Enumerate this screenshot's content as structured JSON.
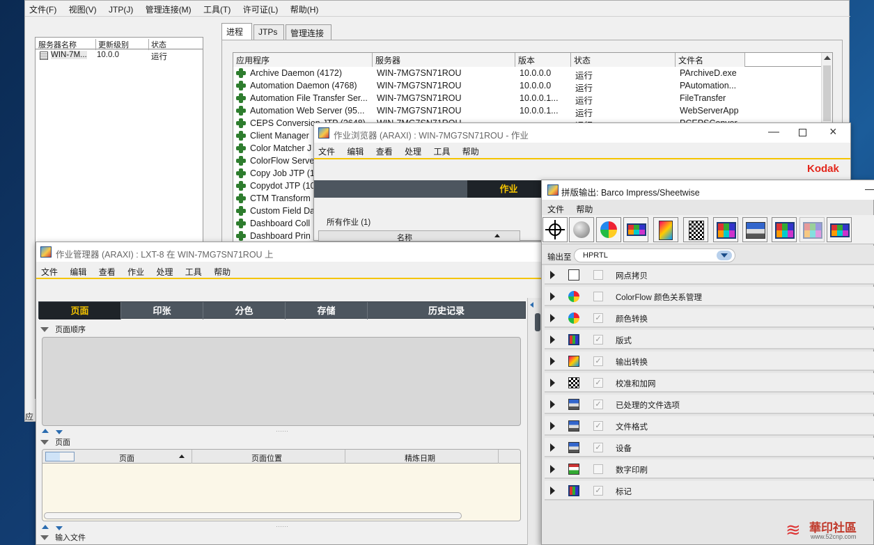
{
  "main_window": {
    "menu": [
      "文件(F)",
      "视图(V)",
      "JTP(J)",
      "管理连接(M)",
      "工具(T)",
      "许可证(L)",
      "帮助(H)"
    ],
    "server_table": {
      "headers": [
        "服务器名称",
        "更新级别",
        "状态"
      ],
      "rows": [
        {
          "name": "WIN-7M...",
          "version": "10.0.0",
          "status": "运行"
        }
      ]
    },
    "tabs": [
      "进程",
      "JTPs",
      "管理连接"
    ],
    "process_table": {
      "headers": [
        "应用程序",
        "服务器",
        "版本",
        "状态",
        "文件名"
      ],
      "rows": [
        [
          "Archive Daemon (4172)",
          "WIN-7MG7SN71ROU",
          "10.0.0.0",
          "运行",
          "PArchiveD.exe"
        ],
        [
          "Automation Daemon (4768)",
          "WIN-7MG7SN71ROU",
          "10.0.0.0",
          "运行",
          "PAutomation..."
        ],
        [
          "Automation File Transfer Ser...",
          "WIN-7MG7SN71ROU",
          "10.0.0.1...",
          "运行",
          "FileTransfer"
        ],
        [
          "Automation Web Server (95...",
          "WIN-7MG7SN71ROU",
          "10.0.0.1...",
          "运行",
          "WebServerApp"
        ],
        [
          "CEPS Conversion JTP (2648)",
          "WIN-7MG7SN71ROU",
          "",
          "运行",
          "PCEPSConver..."
        ],
        [
          "Client Manager",
          "",
          "",
          "",
          ""
        ],
        [
          "Color Matcher J",
          "",
          "",
          "",
          ""
        ],
        [
          "ColorFlow Serve",
          "",
          "",
          "",
          ""
        ],
        [
          "Copy Job JTP (1",
          "",
          "",
          "",
          ""
        ],
        [
          "Copydot JTP (10",
          "",
          "",
          "",
          ""
        ],
        [
          "CTM Transform",
          "",
          "",
          "",
          ""
        ],
        [
          "Custom Field Da",
          "",
          "",
          "",
          ""
        ],
        [
          "Dashboard Coll",
          "",
          "",
          "",
          ""
        ],
        [
          "Dashboard Prin",
          "",
          "",
          "",
          ""
        ]
      ]
    },
    "left_edge_char": "应"
  },
  "job_browser": {
    "title": "作业浏览器 (ARAXI) : WIN-7MG7SN71ROU - 作业",
    "menu": [
      "文件",
      "编辑",
      "查看",
      "处理",
      "工具",
      "帮助"
    ],
    "brand": "Kodak",
    "dark_tab": "作业",
    "all_jobs": "所有作业 (1)",
    "name_col": "名称"
  },
  "job_manager": {
    "title": "作业管理器 (ARAXI) : LXT-8 在 WIN-7MG7SN71ROU 上",
    "menu": [
      "文件",
      "编辑",
      "查看",
      "作业",
      "处理",
      "工具",
      "帮助"
    ],
    "tabs": [
      "页面",
      "印张",
      "分色",
      "存储",
      "历史记录"
    ],
    "page_order_label": "页面顺序",
    "pages_label": "页面",
    "page_cols": [
      "页面",
      "页面位置",
      "精炼日期"
    ],
    "input_files_label": "输入文件"
  },
  "imposition": {
    "title": "拼版输出: Barco Impress/Sheetwise",
    "menu": [
      "文件",
      "帮助"
    ],
    "output_label": "输出至",
    "output_value": "HPRTL",
    "sections": [
      {
        "label": "网点拷贝",
        "checked": false,
        "icon": "target-icon"
      },
      {
        "label": "ColorFlow 颜色关系管理",
        "checked": false,
        "icon": "color-wheel-icon"
      },
      {
        "label": "颜色转换",
        "checked": true,
        "icon": "color-wheel-icon"
      },
      {
        "label": "版式",
        "checked": true,
        "icon": "grid-icon"
      },
      {
        "label": "输出转换",
        "checked": true,
        "icon": "gradient-icon"
      },
      {
        "label": "校准和加网",
        "checked": true,
        "icon": "checker-icon"
      },
      {
        "label": "已处理的文件选项",
        "checked": true,
        "icon": "printer-icon"
      },
      {
        "label": "文件格式",
        "checked": true,
        "icon": "printer-icon"
      },
      {
        "label": "设备",
        "checked": true,
        "icon": "printer-icon"
      },
      {
        "label": "数字印刷",
        "checked": false,
        "icon": "digital-press-icon"
      },
      {
        "label": "标记",
        "checked": true,
        "icon": "grid-icon"
      }
    ]
  },
  "watermark": {
    "site": "華印社區",
    "url": "www.52cnp.com"
  },
  "colors": {
    "accent_yellow": "#f5c400",
    "dark_tab": "#4d565f",
    "kodak_red": "#e3261b"
  }
}
